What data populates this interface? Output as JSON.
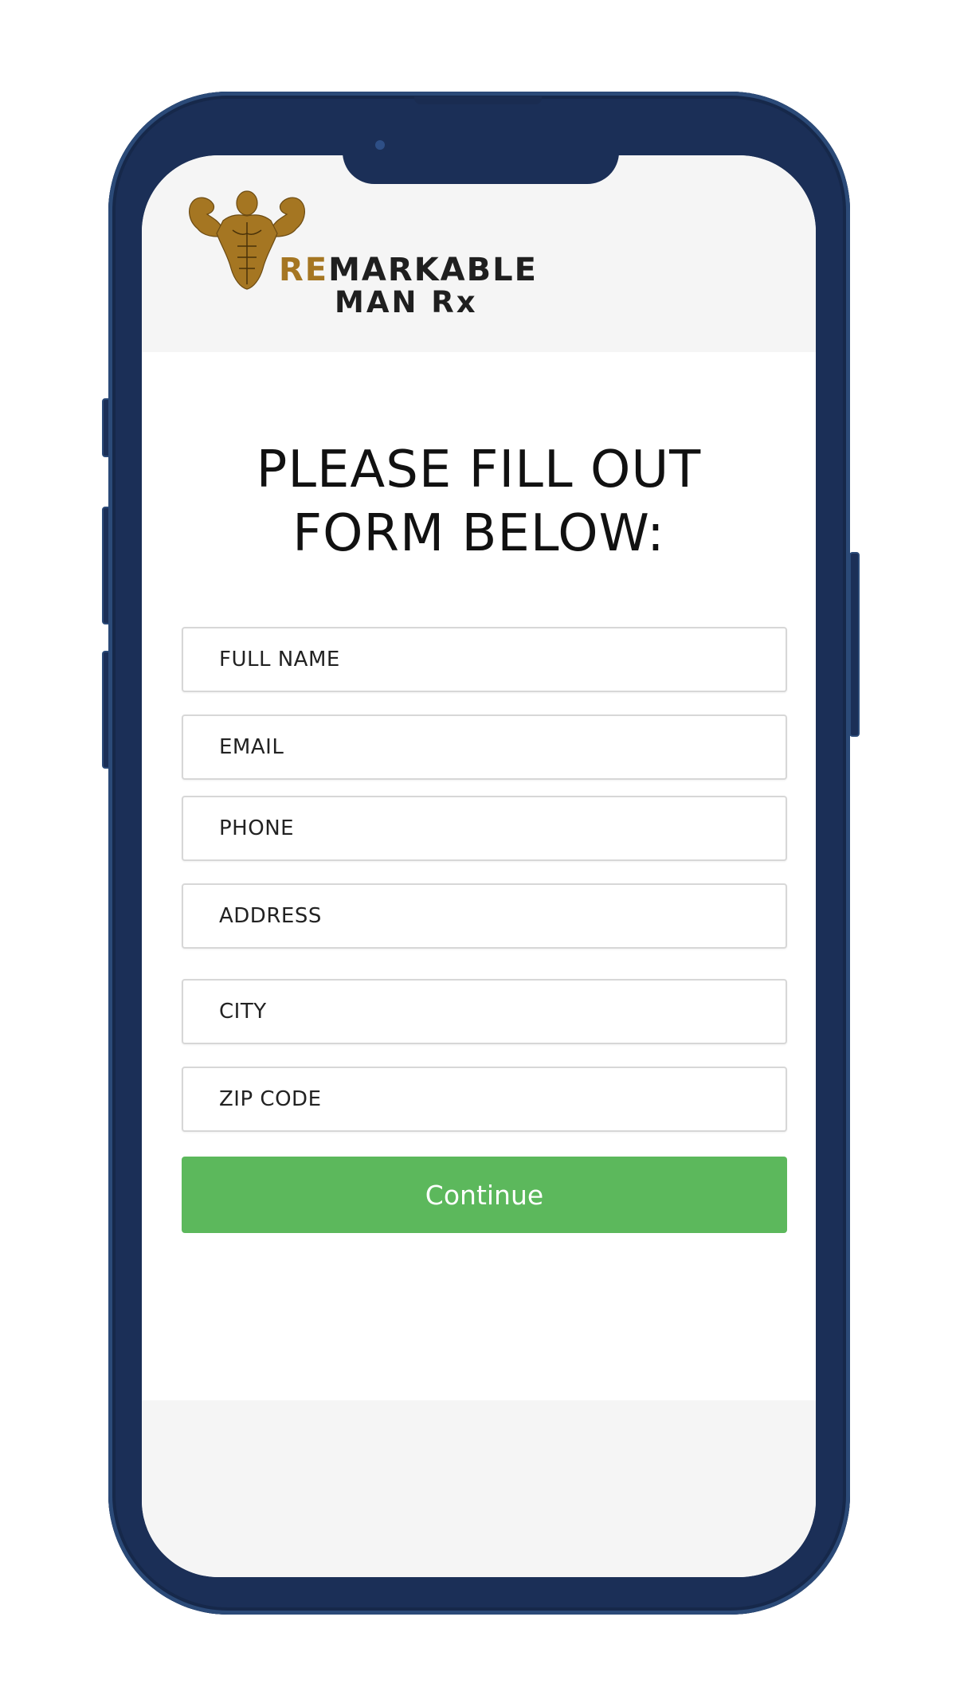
{
  "colors": {
    "phone_frame": "#1b2f57",
    "logo_accent": "#a57622",
    "button": "#5cb85c",
    "page_band": "#f5f5f5"
  },
  "logo": {
    "accent_text": "RE",
    "main_text": "MARKABLE",
    "line2": "MAN Rx",
    "icon": "bodybuilder-flexing-icon"
  },
  "form": {
    "title_line1": "PLEASE FILL OUT",
    "title_line2": "FORM BELOW:",
    "fields": {
      "full_name": {
        "placeholder": "FULL NAME",
        "value": ""
      },
      "email": {
        "placeholder": "EMAIL",
        "value": ""
      },
      "phone": {
        "placeholder": "PHONE",
        "value": ""
      },
      "address": {
        "placeholder": "ADDRESS",
        "value": ""
      },
      "city": {
        "placeholder": "CITY",
        "value": ""
      },
      "zip": {
        "placeholder": "ZIP CODE",
        "value": ""
      }
    },
    "submit_label": "Continue"
  }
}
